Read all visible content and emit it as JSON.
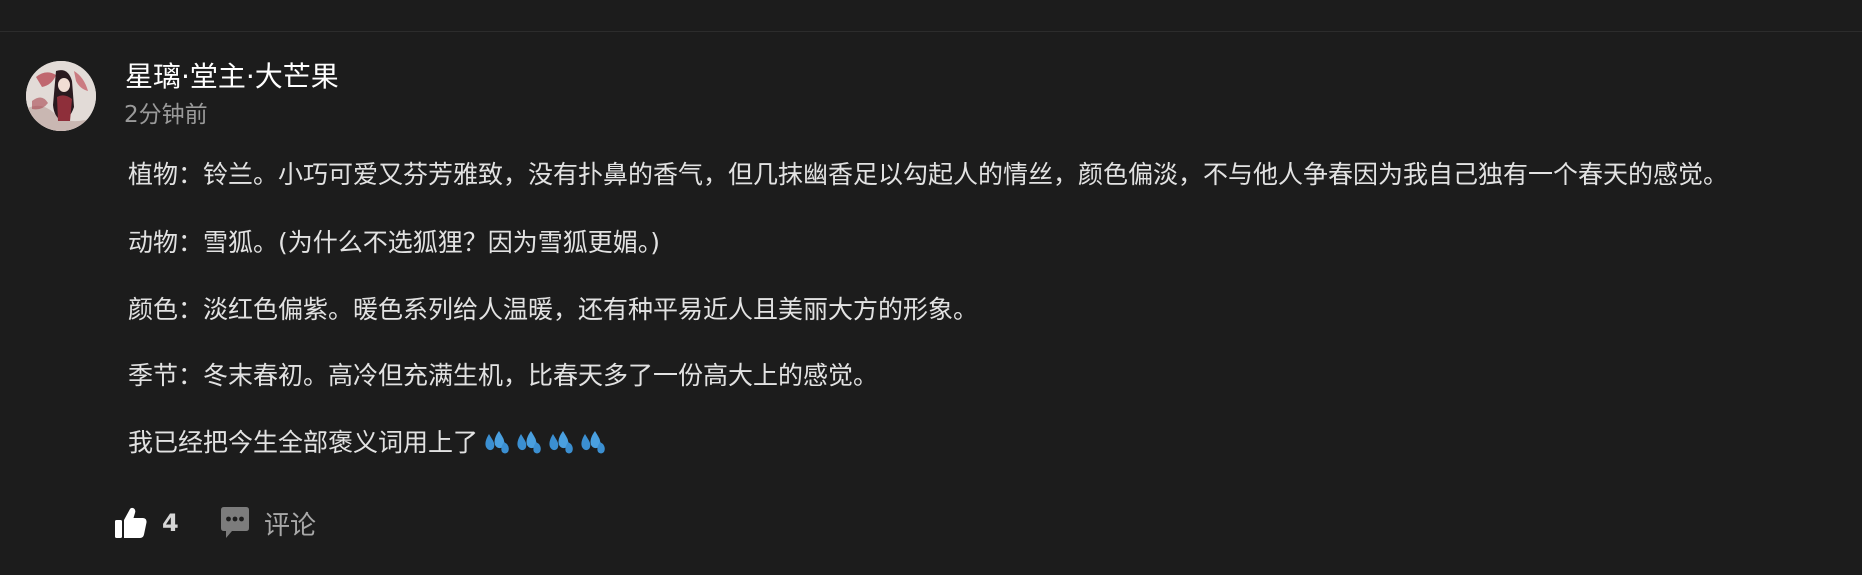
{
  "comment": {
    "username": "星璃·堂主·大芒果",
    "time": "2分钟前",
    "lines": [
      "植物：铃兰。小巧可爱又芬芳雅致，没有扑鼻的香气，但几抹幽香足以勾起人的情丝，颜色偏淡，不与他人争春因为我自己独有一个春天的感觉。",
      "动物：雪狐。(为什么不选狐狸？因为雪狐更媚。)",
      "颜色：淡红色偏紫。暖色系列给人温暖，还有种平易近人且美丽大方的形象。",
      "季节：冬末春初。高冷但充满生机，比春天多了一份高大上的感觉。",
      "我已经把今生全部褒义词用上了"
    ],
    "emoji": [
      "sweat-droplets-emoji",
      "sweat-droplets-emoji",
      "sweat-droplets-emoji",
      "sweat-droplets-emoji"
    ]
  },
  "actions": {
    "like_icon": "thumbs-up-icon",
    "like_count": "4",
    "comment_icon": "comment-bubble-icon",
    "comment_label": "评论"
  },
  "colors": {
    "background": "#1c1c1c",
    "username": "#ffffff",
    "time": "#9a9a9a",
    "body_text": "#e2e2e2",
    "emoji_blue": "#3b8fd1"
  }
}
